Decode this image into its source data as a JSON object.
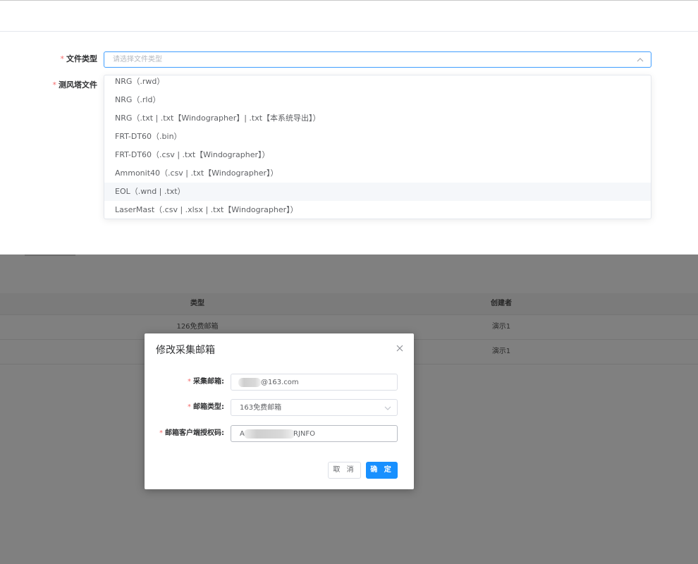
{
  "form": {
    "file_type": {
      "label": "文件类型",
      "placeholder": "请选择文件类型",
      "options": [
        "NRG（.rwd）",
        "NRG（.rld）",
        "NRG（.txt | .txt【Windographer】| .txt【本系统导出】）",
        "FRT-DT60（.bin）",
        "FRT-DT60（.csv | .txt【Windographer】）",
        "Ammonit40（.csv | .txt【Windographer】）",
        "EOL（.wnd | .txt）",
        "LaserMast（.csv | .xlsx | .txt【Windographer】）"
      ],
      "hovered_option": "EOL（.wnd | .txt）"
    },
    "tower_file": {
      "label": "测风塔文件"
    },
    "required_mark": "*"
  },
  "table": {
    "headers": {
      "type": "类型",
      "creator": "创建者"
    },
    "rows": [
      {
        "type": "126免费邮箱",
        "creator": "演示1"
      },
      {
        "type": "",
        "creator": "演示1"
      }
    ]
  },
  "modal": {
    "title": "修改采集邮箱",
    "fields": {
      "email": {
        "label": "采集邮箱:",
        "value": "@163.com"
      },
      "mailbox_type": {
        "label": "邮箱类型:",
        "value": "163免费邮箱"
      },
      "auth_code": {
        "label": "邮箱客户端授权码:",
        "value": "A",
        "value_tail": "RJNFO"
      }
    },
    "buttons": {
      "cancel": "取 消",
      "ok": "确 定"
    }
  },
  "colors": {
    "primary": "#1890ff",
    "focus_border": "#409eff",
    "required": "#f56c6c",
    "overlay": "#808080"
  }
}
